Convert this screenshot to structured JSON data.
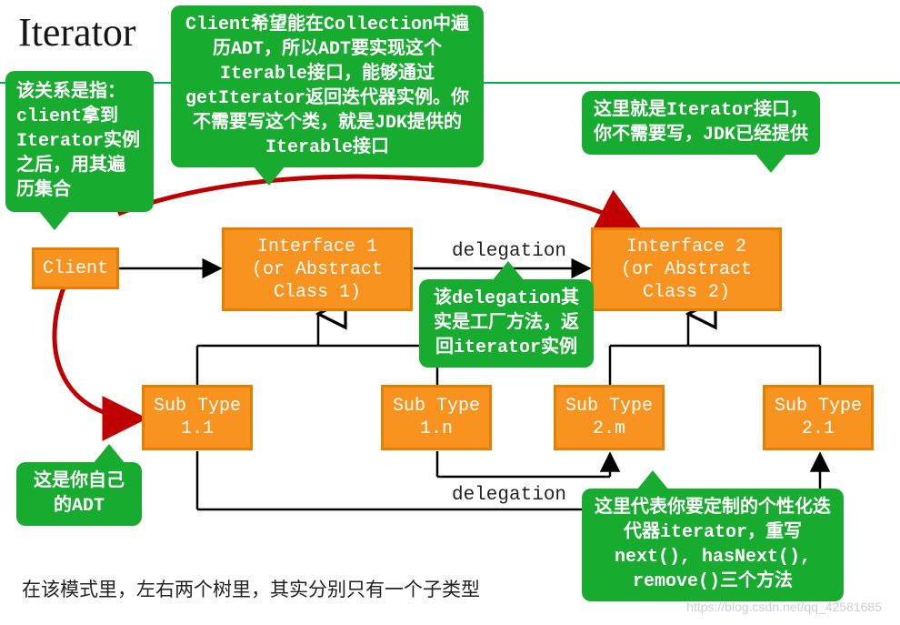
{
  "title": "Iterator",
  "boxes": {
    "client": "Client",
    "if1": "Interface 1\n(or Abstract\nClass 1)",
    "if2": "Interface 2\n(or Abstract\nClass 2)",
    "s11": "Sub Type\n1.1",
    "s1n": "Sub Type\n1.n",
    "s2m": "Sub Type\n2.m",
    "s21": "Sub Type\n2.1"
  },
  "labels": {
    "delegation1": "delegation",
    "delegation2": "delegation"
  },
  "callouts": {
    "top_center": "Client希望能在Collection中遍历ADT，所以ADT要实现这个Iterable接口，能够通过getIterator返回迭代器实例。你不需要写这个类，就是JDK提供的Iterable接口",
    "top_right": "这里就是Iterator接口，你不需要写，JDK已经提供",
    "left": "该关系是指：client拿到Iterator实例之后，用其遍历集合",
    "mid_delegation": "该delegation其实是工厂方法，返回iterator实例",
    "bottom_left": "这是你自己的ADT",
    "bottom_right": "这里代表你要定制的个性化迭代器iterator，重写next(), hasNext(), remove()三个方法"
  },
  "footer": "在该模式里，左右两个树里，其实分别只有一个子类型",
  "watermark": "https://blog.csdn.net/qq_42581685"
}
